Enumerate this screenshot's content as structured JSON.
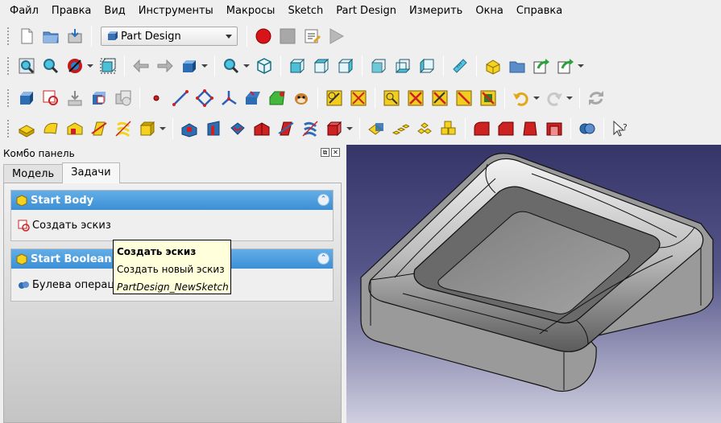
{
  "menubar": {
    "items": [
      "Файл",
      "Правка",
      "Вид",
      "Инструменты",
      "Макросы",
      "Sketch",
      "Part Design",
      "Измерить",
      "Окна",
      "Справка"
    ]
  },
  "toolbar1": {
    "workbench_selected": "Part Design"
  },
  "combo": {
    "title": "Комбо панель",
    "tabs": [
      "Модель",
      "Задачи"
    ],
    "active_tab": "Задачи"
  },
  "tasks": {
    "body": {
      "title": "Start Body",
      "action": "Создать эскиз"
    },
    "boolean": {
      "title": "Start Boolean",
      "action": "Булева операци"
    }
  },
  "tooltip": {
    "title": "Создать эскиз",
    "description": "Создать новый эскиз",
    "command": "PartDesign_NewSketch"
  },
  "colors": {
    "task_header": "#3b8fd5",
    "viewport_top": "#353568",
    "viewport_bottom": "#cfcfe0",
    "tooltip_bg": "#ffffdc"
  }
}
